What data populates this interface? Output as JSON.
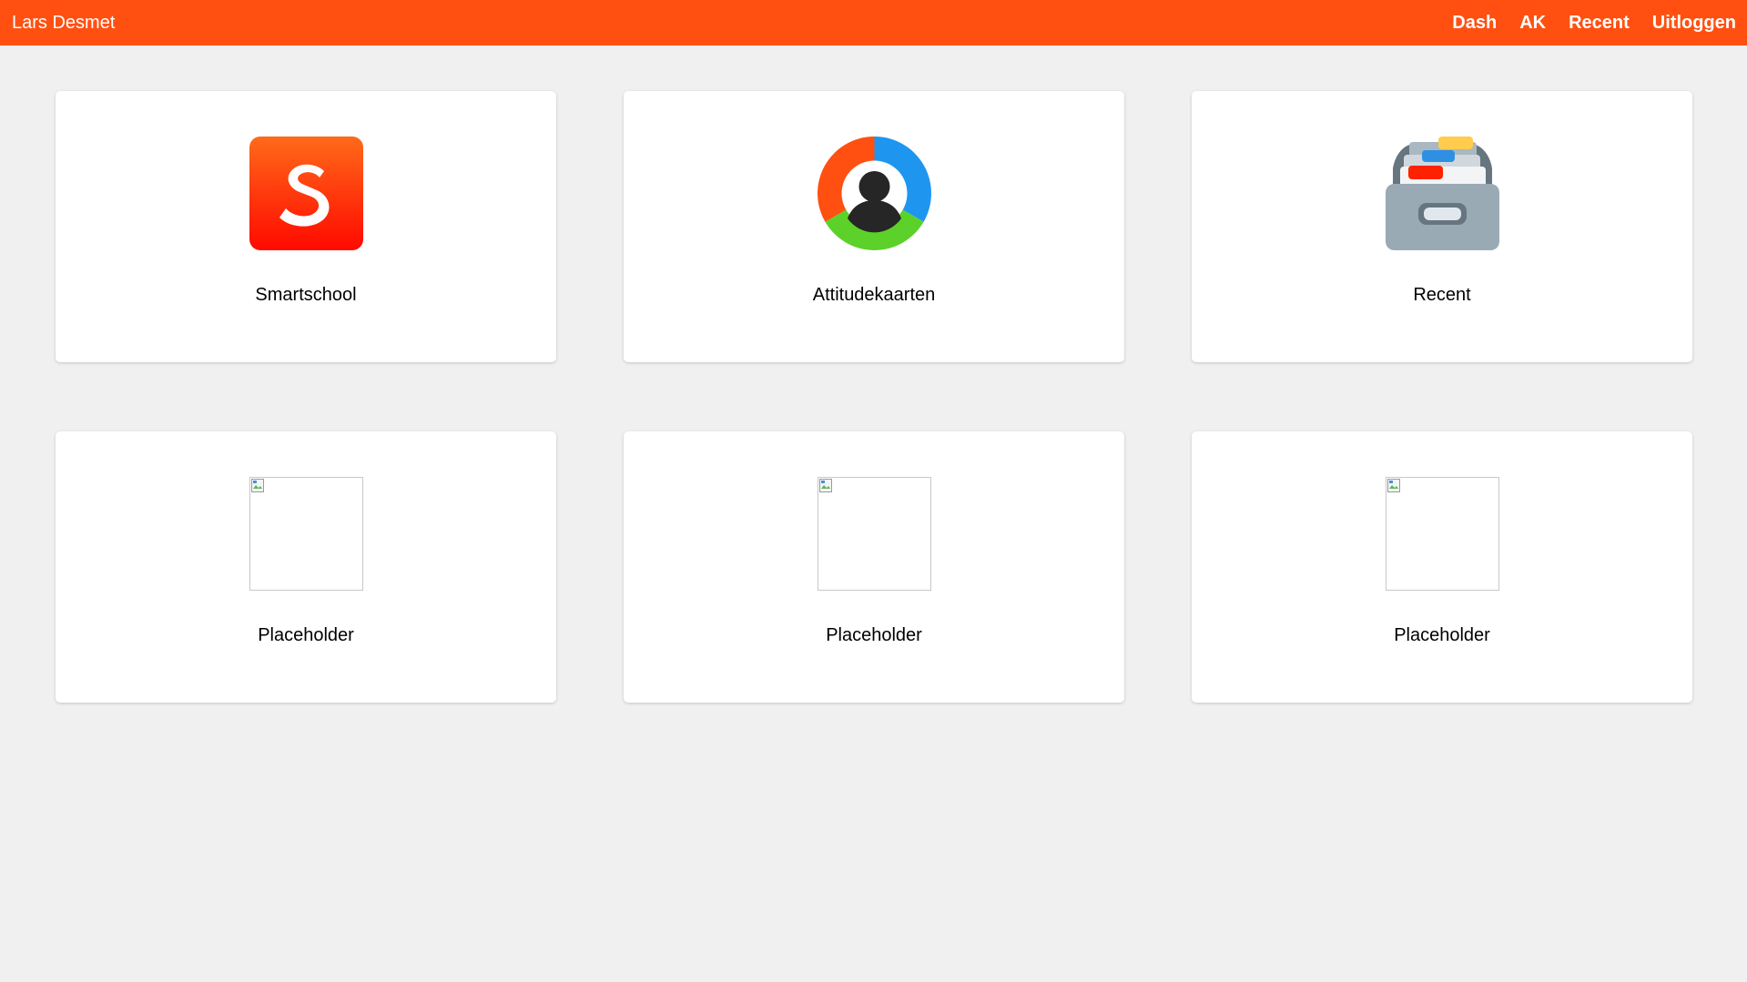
{
  "header": {
    "user_name": "Lars Desmet",
    "nav": [
      {
        "label": "Dash"
      },
      {
        "label": "AK"
      },
      {
        "label": "Recent"
      },
      {
        "label": "Uitloggen"
      }
    ],
    "background_color": "#ff5011"
  },
  "cards": [
    {
      "label": "Smartschool",
      "icon": "smartschool-logo-icon"
    },
    {
      "label": "Attitudekaarten",
      "icon": "attitudekaarten-logo-icon"
    },
    {
      "label": "Recent",
      "icon": "card-file-box-icon"
    },
    {
      "label": "Placeholder",
      "icon": "broken-image-icon"
    },
    {
      "label": "Placeholder",
      "icon": "broken-image-icon"
    },
    {
      "label": "Placeholder",
      "icon": "broken-image-icon"
    }
  ]
}
